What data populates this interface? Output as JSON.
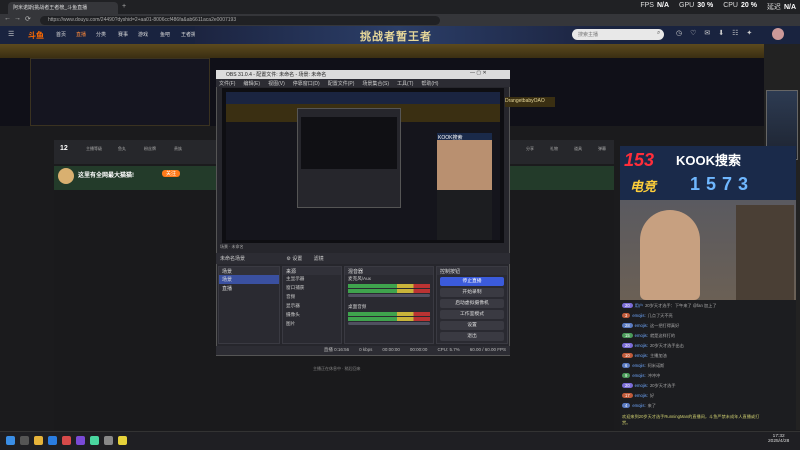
{
  "browser": {
    "tab_title": "阿米诺斯|挑战者王者榜_斗鱼直播",
    "new_tab": "+",
    "url": "https://www.douyu.com/24490?dyshid=2+aa01-8006ccf486fa&ab6611aca2e0007193",
    "nav": {
      "back": "←",
      "forward": "→",
      "reload": "⟳"
    }
  },
  "stats": [
    {
      "label": "FPS",
      "value": "N/A"
    },
    {
      "label": "GPU",
      "value": "30 %"
    },
    {
      "label": "CPU",
      "value": "20 %"
    },
    {
      "label": "延迟",
      "value": "N/A"
    }
  ],
  "douyu": {
    "brand": "斗鱼",
    "nav": [
      "首页",
      "直播",
      "分类",
      "赛事",
      "游戏",
      "鱼吧",
      "王者挑战"
    ],
    "banner": "挑战者暂王者",
    "search_placeholder": "搜索主播"
  },
  "player_bar": {
    "count": "12",
    "items": [
      "主播等级",
      "鱼丸",
      "粉丝牌",
      "贵族",
      "超管",
      "订阅",
      "开通提醒",
      "下载",
      "分享",
      "礼物",
      "道具",
      "弹幕",
      "举报"
    ]
  },
  "anchor": {
    "title": "这里有全网最大猫猫!",
    "tag": "关注"
  },
  "bottom_hint": "主播正在休息中 · 稍后回来",
  "kook": {
    "num": "153",
    "brand": "KOOK搜索",
    "code": "1573",
    "sub": "电竞"
  },
  "chat": [
    {
      "badge": "20",
      "color": "#7a6bd6",
      "nick": "用户",
      "text": "20岁天才选手：下午来了 @fan 加上了"
    },
    {
      "badge": "3",
      "color": "#c05a3a",
      "nick": "emojis:",
      "text": "几点了天不亮"
    },
    {
      "badge": "28",
      "color": "#5a7ac0",
      "nick": "emojis:",
      "text": "这一把打得真好"
    },
    {
      "badge": "15",
      "color": "#4a9a5a",
      "nick": "emojis:",
      "text": "就是这样打的"
    },
    {
      "badge": "20",
      "color": "#7a6bd6",
      "nick": "emojis:",
      "text": "20岁天才选手出击"
    },
    {
      "badge": "10",
      "color": "#c05a3a",
      "nick": "emojis:",
      "text": "主播加油"
    },
    {
      "badge": "6",
      "color": "#5a7ac0",
      "nick": "emojis:",
      "text": "阿米诺斯"
    },
    {
      "badge": "9",
      "color": "#4a9a5a",
      "nick": "emojis:",
      "text": "冲冲冲"
    },
    {
      "badge": "20",
      "color": "#7a6bd6",
      "nick": "emojis:",
      "text": "20岁天才选手"
    },
    {
      "badge": "17",
      "color": "#c05a3a",
      "nick": "emojis:",
      "text": "好"
    },
    {
      "badge": "4",
      "color": "#5a7ac0",
      "nick": "emojis:",
      "text": "来了"
    }
  ],
  "chat_notice": "欢迎来到20岁天才选手RunningMan的直播间，斗鱼严禁未成年人直播或打赏。",
  "obs": {
    "title": "OBS 31.0.4 - 配置文件: 未命名 - 场景: 未命名",
    "menu": [
      "文件(F)",
      "编辑(E)",
      "视图(V)",
      "停靠窗口(D)",
      "配置文件(P)",
      "场景集合(S)",
      "工具(T)",
      "帮助(H)"
    ],
    "status_line": "场景 · 未命名",
    "scenebar": [
      "未命名场景",
      "⚙ 设置",
      "滤镜"
    ],
    "scenes_title": "场景",
    "scenes": [
      "场景",
      "直播"
    ],
    "sources_title": "来源",
    "sources": [
      "主显示器",
      "窗口捕获",
      "音频",
      "显示器",
      "摄像头",
      "图片"
    ],
    "mixer_title": "混音器",
    "mixer": [
      "麦克风/Aux",
      "桌面音频"
    ],
    "controls_title": "控制按钮",
    "controls": [
      "停止直播",
      "开始录制",
      "启动虚拟摄像机",
      "工作室模式",
      "设置",
      "退出"
    ],
    "status": [
      "直播 0:16:56",
      "0 kbps",
      "00:00:00",
      "00:00:00",
      "CPU: 5.7%",
      "60.00 / 60.00 FPS"
    ],
    "window_buttons": "—  ▢  ✕"
  },
  "preview": {
    "label": "DrangetbabyOAO",
    "kook": "KOOK搜索"
  },
  "clock": {
    "time": "17:32",
    "date": "2025/4/28"
  }
}
